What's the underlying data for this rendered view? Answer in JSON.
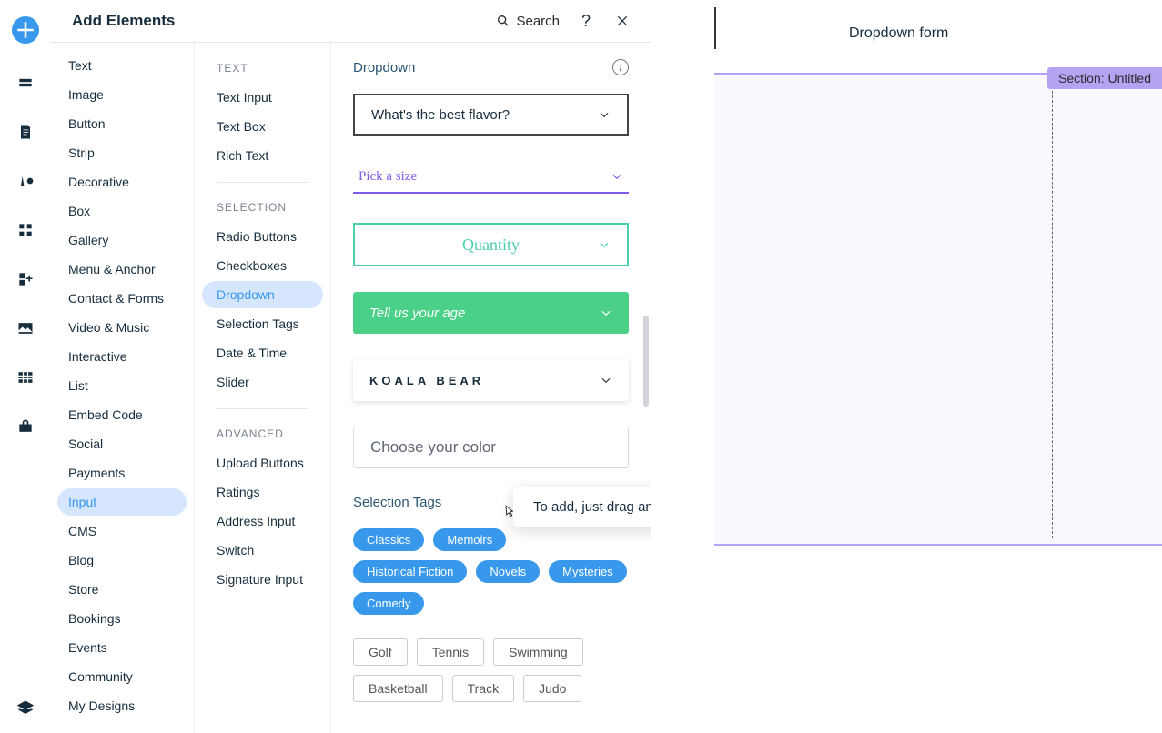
{
  "panel": {
    "title": "Add Elements",
    "search_label": "Search"
  },
  "categories": [
    "Text",
    "Image",
    "Button",
    "Strip",
    "Decorative",
    "Box",
    "Gallery",
    "Menu & Anchor",
    "Contact & Forms",
    "Video & Music",
    "Interactive",
    "List",
    "Embed Code",
    "Social",
    "Payments",
    "Input",
    "CMS",
    "Blog",
    "Store",
    "Bookings",
    "Events",
    "Community",
    "My Designs"
  ],
  "categories_active": "Input",
  "subcol": {
    "groups": [
      {
        "head": "TEXT",
        "items": [
          "Text Input",
          "Text Box",
          "Rich Text"
        ]
      },
      {
        "head": "SELECTION",
        "items": [
          "Radio Buttons",
          "Checkboxes",
          "Dropdown",
          "Selection Tags",
          "Date & Time",
          "Slider"
        ]
      },
      {
        "head": "ADVANCED",
        "items": [
          "Upload Buttons",
          "Ratings",
          "Address Input",
          "Switch",
          "Signature Input"
        ]
      }
    ],
    "active": "Dropdown"
  },
  "preview": {
    "dropdown_heading": "Dropdown",
    "selection_tags_heading": "Selection Tags",
    "dd1": "What's the best flavor?",
    "dd2": "Pick a size",
    "dd3": "Quantity",
    "dd4": "Tell us your age",
    "dd5": "KOALA BEAR",
    "dd6": "Choose your color",
    "tags_blue": [
      "Classics",
      "Memoirs",
      "Historical Fiction",
      "Novels",
      "Mysteries",
      "Comedy"
    ],
    "tags_box": [
      "Golf",
      "Tennis",
      "Swimming",
      "Basketball",
      "Track",
      "Judo"
    ]
  },
  "tooltip_text": "To add, just drag and drop.",
  "canvas": {
    "header_text": "Dropdown form",
    "section_label": "Section: Untitled"
  }
}
